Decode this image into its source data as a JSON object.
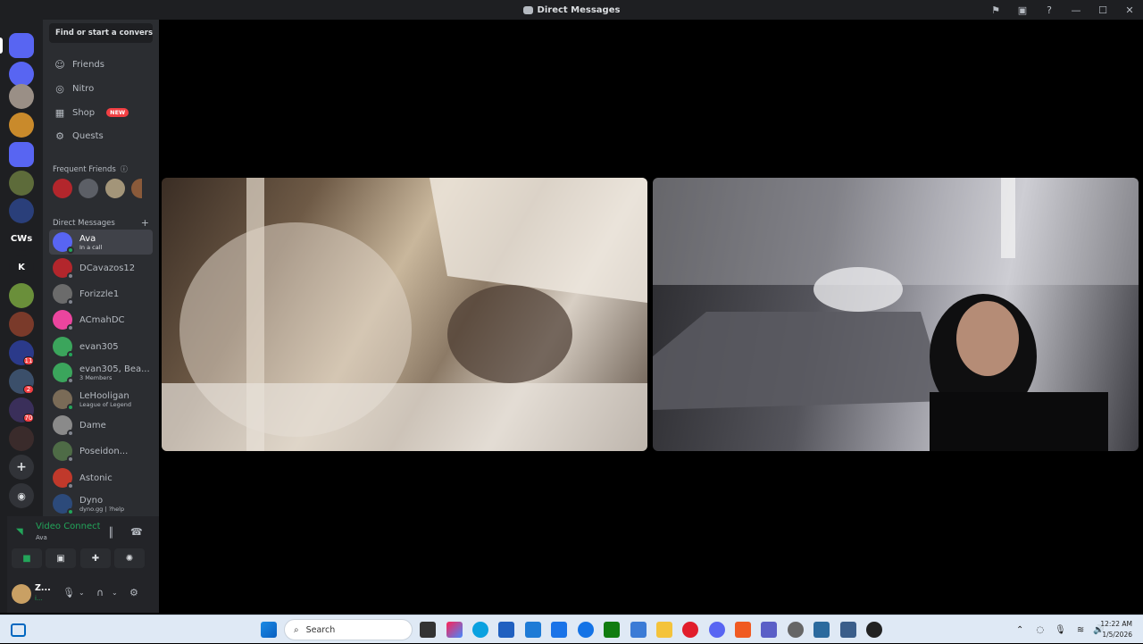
{
  "window": {
    "title": "Direct Messages"
  },
  "sidebar": {
    "search_label": "Find or start a convers...",
    "nav": [
      {
        "label": "Friends",
        "icon": "friends-icon"
      },
      {
        "label": "Nitro",
        "icon": "nitro-icon"
      },
      {
        "label": "Shop",
        "icon": "shop-icon",
        "badge": "NEW"
      },
      {
        "label": "Quests",
        "icon": "quests-icon"
      }
    ],
    "frequent_friends_label": "Frequent Friends",
    "direct_messages_label": "Direct Messages",
    "dms": [
      {
        "name": "Ava",
        "sub": "In a call",
        "online": true,
        "active": true,
        "color": "#5865f2"
      },
      {
        "name": "DCavazos12",
        "sub": "",
        "online": false,
        "color": "#b3262c"
      },
      {
        "name": "Forizzle1",
        "sub": "",
        "online": false,
        "color": "#6b6b6b"
      },
      {
        "name": "ACmahDC",
        "sub": "",
        "online": false,
        "color": "#eb459e"
      },
      {
        "name": "evan305",
        "sub": "",
        "online": true,
        "color": "#3ba55c"
      },
      {
        "name": "evan305, Bea...",
        "sub": "3 Members",
        "online": false,
        "color": "#3ba55c"
      },
      {
        "name": "LeHooligan",
        "sub": "League of Legend",
        "online": true,
        "color": "#7a6b57"
      },
      {
        "name": "Dame",
        "sub": "",
        "online": false,
        "color": "#8a8a8a"
      },
      {
        "name": "Poseidon...",
        "sub": "",
        "online": false,
        "color": "#4e6b46"
      },
      {
        "name": "Astonic",
        "sub": "",
        "online": false,
        "color": "#c0392b"
      },
      {
        "name": "Dyno",
        "sub": "dyno.gg | ?help",
        "online": true,
        "color": "#2c4a7a"
      }
    ]
  },
  "rail": {
    "servers": [
      {
        "label": "",
        "color": "#5865f2"
      },
      {
        "label": "",
        "color": "#5865f2"
      },
      {
        "label": "",
        "color": "#9a8f86"
      },
      {
        "label": "",
        "color": "#c98a2b"
      },
      {
        "label": "",
        "color": "#5865f2"
      },
      {
        "label": "",
        "color": "#5d6b3a"
      },
      {
        "label": "",
        "color": "#2a3f7a"
      },
      {
        "label": "CWs",
        "color": "#1e1f22"
      },
      {
        "label": "K",
        "color": "#1e1f22"
      },
      {
        "label": "",
        "color": "#6a8f3a"
      },
      {
        "label": "",
        "color": "#7a3a2a"
      },
      {
        "label": "",
        "color": "#2b3a8a"
      },
      {
        "label": "",
        "color": "#3b4f6a"
      },
      {
        "label": "",
        "color": "#3a2f5a"
      },
      {
        "label": "",
        "color": "#3a2b2b"
      }
    ],
    "badges": [
      "11",
      "2",
      "70"
    ]
  },
  "voice": {
    "status": "Video Connected",
    "channel": "Ava"
  },
  "user": {
    "name": "Z...",
    "status": "i..."
  },
  "taskbar": {
    "search_placeholder": "Search",
    "time": "12:22 AM",
    "date": "1/5/2026"
  }
}
